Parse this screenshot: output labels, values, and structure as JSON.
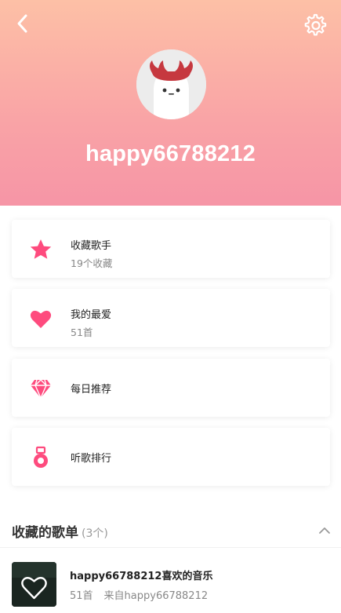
{
  "user": {
    "username": "happy66788212"
  },
  "cards": [
    {
      "icon": "star-icon",
      "title": "收藏歌手",
      "subtitle": "19个收藏"
    },
    {
      "icon": "heart-icon",
      "title": "我的最爱",
      "subtitle": "51首"
    },
    {
      "icon": "diamond-icon",
      "title": "每日推荐",
      "subtitle": ""
    },
    {
      "icon": "medal-icon",
      "title": "听歌排行",
      "subtitle": ""
    }
  ],
  "section": {
    "title": "收藏的歌单",
    "count": "(3个)"
  },
  "playlists": [
    {
      "name": "happy66788212喜欢的音乐",
      "count": "51首",
      "source": "来自happy66788212"
    }
  ],
  "colors": {
    "accent": "#fe4b7e",
    "header_top": "#fdc0a6",
    "header_bottom": "#f695a6"
  }
}
